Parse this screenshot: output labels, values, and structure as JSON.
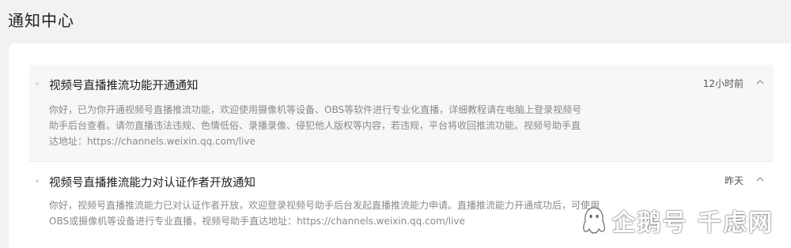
{
  "header": {
    "title": "通知中心"
  },
  "notifications": [
    {
      "title": "视频号直播推流功能开通通知",
      "time": "12小时前",
      "body": "你好，已为你开通视频号直播推流功能，欢迎使用摄像机等设备、OBS等软件进行专业化直播，详细教程请在电脑上登录视频号助手后台查看。请勿直播违法违规、色情低俗、录播录像、侵犯他人版权等内容，若违规，平台将收回推流功能。视频号助手直达地址：https://channels.weixin.qq.com/live",
      "expanded": true
    },
    {
      "title": "视频号直播推流能力对认证作者开放通知",
      "time": "昨天",
      "body": "你好，视频号直播推流能力已对认证作者开放，欢迎登录视频号助手后台发起直播推流能力申请。直播推流能力开通成功后，可使用OBS或摄像机等设备进行专业直播，视频号助手直达地址：https://channels.weixin.qq.com/live",
      "expanded": true
    }
  ],
  "watermark": {
    "text": "企鹅号 千虑网"
  },
  "colors": {
    "page_bg": "#f2f2f2",
    "card_bg": "#ffffff",
    "active_item_bg": "#f7f7f7",
    "title_text": "#1f1f1f",
    "body_text": "#8a8a8a"
  },
  "icons": [
    "chevron-up-icon",
    "bullet-dot-icon",
    "penguin-logo-icon"
  ]
}
